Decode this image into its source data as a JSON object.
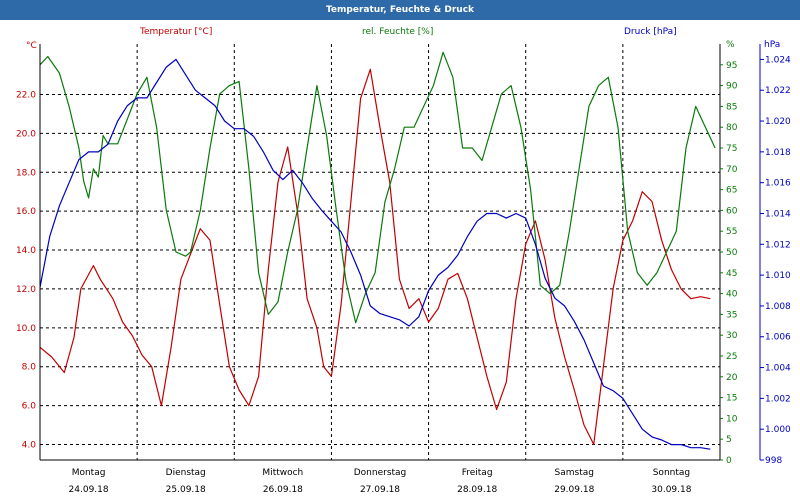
{
  "window": {
    "title": "Temperatur, Feuchte & Druck"
  },
  "chart_data": {
    "type": "line",
    "title": "Temperatur, Feuchte & Druck",
    "grid": true,
    "colors": {
      "temperature": "#c00000",
      "humidity": "#0a7a0a",
      "pressure": "#0000c0",
      "titlebar": "#2e6aa8"
    },
    "axes": {
      "temperature": {
        "unit": "°C",
        "ylim": [
          3.2,
          24.6
        ],
        "ticks": [
          "4.0",
          "6.0",
          "8.0",
          "10.0",
          "12.0",
          "14.0",
          "16.0",
          "18.0",
          "20.0",
          "22.0"
        ]
      },
      "humidity": {
        "unit": "%",
        "ylim": [
          0,
          100
        ],
        "ticks": [
          "0",
          "5",
          "10",
          "15",
          "20",
          "25",
          "30",
          "35",
          "40",
          "45",
          "50",
          "55",
          "60",
          "65",
          "70",
          "75",
          "80",
          "85",
          "90",
          "95"
        ],
        "top_label": "%"
      },
      "pressure": {
        "unit": "hPa",
        "ylim": [
          0.998,
          1.025
        ],
        "ticks": [
          "998",
          "1.000",
          "1.002",
          "1.004",
          "1.006",
          "1.008",
          "1.010",
          "1.012",
          "1.014",
          "1.016",
          "1.018",
          "1.020",
          "1.022",
          "1.024"
        ],
        "top_label": "hPa"
      }
    },
    "x_labels": [
      {
        "day": "Montag",
        "date": "24.09.18"
      },
      {
        "day": "Dienstag",
        "date": "25.09.18"
      },
      {
        "day": "Mittwoch",
        "date": "26.09.18"
      },
      {
        "day": "Donnerstag",
        "date": "27.09.18"
      },
      {
        "day": "Freitag",
        "date": "28.09.18"
      },
      {
        "day": "Samstag",
        "date": "29.09.18"
      },
      {
        "day": "Sonntag",
        "date": "30.09.18"
      }
    ],
    "x_range_days": [
      0,
      7
    ],
    "series": [
      {
        "name": "Temperatur [°C]",
        "axis": "temperature",
        "x": [
          0,
          0.12,
          0.25,
          0.35,
          0.42,
          0.55,
          0.62,
          0.75,
          0.85,
          0.95,
          1.05,
          1.15,
          1.25,
          1.35,
          1.45,
          1.55,
          1.65,
          1.75,
          1.85,
          1.95,
          2.05,
          2.15,
          2.25,
          2.35,
          2.45,
          2.55,
          2.65,
          2.75,
          2.85,
          2.92,
          3.0,
          3.1,
          3.2,
          3.3,
          3.4,
          3.5,
          3.6,
          3.7,
          3.8,
          3.9,
          4.0,
          4.1,
          4.2,
          4.3,
          4.4,
          4.5,
          4.6,
          4.7,
          4.8,
          4.9,
          5.0,
          5.1,
          5.2,
          5.3,
          5.4,
          5.5,
          5.6,
          5.7,
          5.8,
          5.9,
          6.0,
          6.1,
          6.2,
          6.3,
          6.4,
          6.5,
          6.6,
          6.7,
          6.8,
          6.9
        ],
        "values": [
          9.0,
          8.5,
          7.7,
          9.5,
          12.0,
          13.2,
          12.5,
          11.5,
          10.3,
          9.6,
          8.6,
          8.0,
          6.0,
          9.0,
          12.5,
          13.8,
          15.1,
          14.5,
          11.2,
          8.0,
          6.8,
          6.0,
          7.5,
          13.0,
          17.5,
          19.3,
          16.0,
          11.5,
          10.0,
          8.0,
          7.5,
          11.2,
          16.5,
          21.8,
          23.3,
          20.3,
          17.5,
          12.5,
          11.0,
          11.5,
          10.3,
          11.0,
          12.5,
          12.8,
          11.5,
          9.5,
          7.5,
          5.8,
          7.2,
          11.5,
          14.3,
          15.5,
          13.5,
          10.5,
          8.5,
          6.8,
          5.0,
          4.0,
          8.0,
          12.0,
          14.5,
          15.5,
          17.0,
          16.5,
          14.5,
          13.0,
          12.0,
          11.5,
          11.6,
          11.5
        ]
      },
      {
        "name": "rel. Feuchte [%]",
        "axis": "humidity",
        "x": [
          0,
          0.08,
          0.2,
          0.3,
          0.4,
          0.45,
          0.5,
          0.55,
          0.6,
          0.65,
          0.7,
          0.8,
          0.9,
          1.0,
          1.1,
          1.2,
          1.3,
          1.4,
          1.5,
          1.55,
          1.65,
          1.75,
          1.85,
          1.95,
          2.05,
          2.15,
          2.25,
          2.35,
          2.45,
          2.55,
          2.65,
          2.75,
          2.85,
          2.95,
          3.05,
          3.15,
          3.25,
          3.35,
          3.45,
          3.55,
          3.65,
          3.75,
          3.85,
          3.95,
          4.05,
          4.15,
          4.25,
          4.35,
          4.45,
          4.55,
          4.65,
          4.75,
          4.85,
          4.95,
          5.05,
          5.15,
          5.25,
          5.35,
          5.45,
          5.55,
          5.65,
          5.75,
          5.85,
          5.95,
          6.05,
          6.15,
          6.25,
          6.35,
          6.45,
          6.55,
          6.65,
          6.75,
          6.85,
          6.95
        ],
        "values": [
          95,
          97,
          93,
          85,
          75,
          67,
          63,
          70,
          68,
          78,
          76,
          76,
          82,
          88,
          92,
          80,
          60,
          50,
          49,
          50,
          60,
          75,
          88,
          90,
          91,
          70,
          45,
          35,
          38,
          50,
          60,
          75,
          90,
          78,
          60,
          43,
          33,
          40,
          45,
          62,
          70,
          80,
          80,
          85,
          90,
          98,
          92,
          75,
          75,
          72,
          80,
          88,
          90,
          80,
          65,
          42,
          40,
          42,
          55,
          70,
          85,
          90,
          92,
          80,
          55,
          45,
          42,
          45,
          50,
          55,
          75,
          85,
          80,
          75
        ]
      },
      {
        "name": "Druck [hPa]",
        "axis": "pressure",
        "x": [
          0,
          0.1,
          0.2,
          0.3,
          0.4,
          0.5,
          0.6,
          0.7,
          0.8,
          0.9,
          1.0,
          1.1,
          1.2,
          1.3,
          1.4,
          1.5,
          1.6,
          1.7,
          1.8,
          1.9,
          2.0,
          2.1,
          2.2,
          2.3,
          2.4,
          2.5,
          2.6,
          2.7,
          2.8,
          2.9,
          3.0,
          3.1,
          3.2,
          3.3,
          3.4,
          3.5,
          3.6,
          3.7,
          3.8,
          3.9,
          4.0,
          4.1,
          4.2,
          4.3,
          4.4,
          4.5,
          4.6,
          4.7,
          4.8,
          4.9,
          5.0,
          5.1,
          5.2,
          5.3,
          5.4,
          5.5,
          5.6,
          5.7,
          5.8,
          5.9,
          6.0,
          6.1,
          6.2,
          6.3,
          6.4,
          6.5,
          6.6,
          6.7,
          6.8,
          6.9
        ],
        "values": [
          1.0092,
          1.0125,
          1.0145,
          1.016,
          1.0175,
          1.018,
          1.018,
          1.0185,
          1.02,
          1.021,
          1.0215,
          1.0215,
          1.0225,
          1.0235,
          1.024,
          1.023,
          1.022,
          1.0215,
          1.021,
          1.02,
          1.0195,
          1.0195,
          1.019,
          1.018,
          1.0168,
          1.0162,
          1.0168,
          1.016,
          1.015,
          1.0142,
          1.0135,
          1.0128,
          1.0115,
          1.01,
          1.008,
          1.0075,
          1.0073,
          1.0071,
          1.0067,
          1.0073,
          1.009,
          1.01,
          1.0105,
          1.0113,
          1.0125,
          1.0135,
          1.014,
          1.014,
          1.0137,
          1.014,
          1.0137,
          1.012,
          1.0098,
          1.0085,
          1.008,
          1.007,
          1.0058,
          1.0043,
          1.0028,
          1.0025,
          1.002,
          1.001,
          1.0,
          0.9995,
          0.9993,
          0.999,
          0.999,
          0.9988,
          0.9988,
          0.9987
        ]
      }
    ]
  }
}
